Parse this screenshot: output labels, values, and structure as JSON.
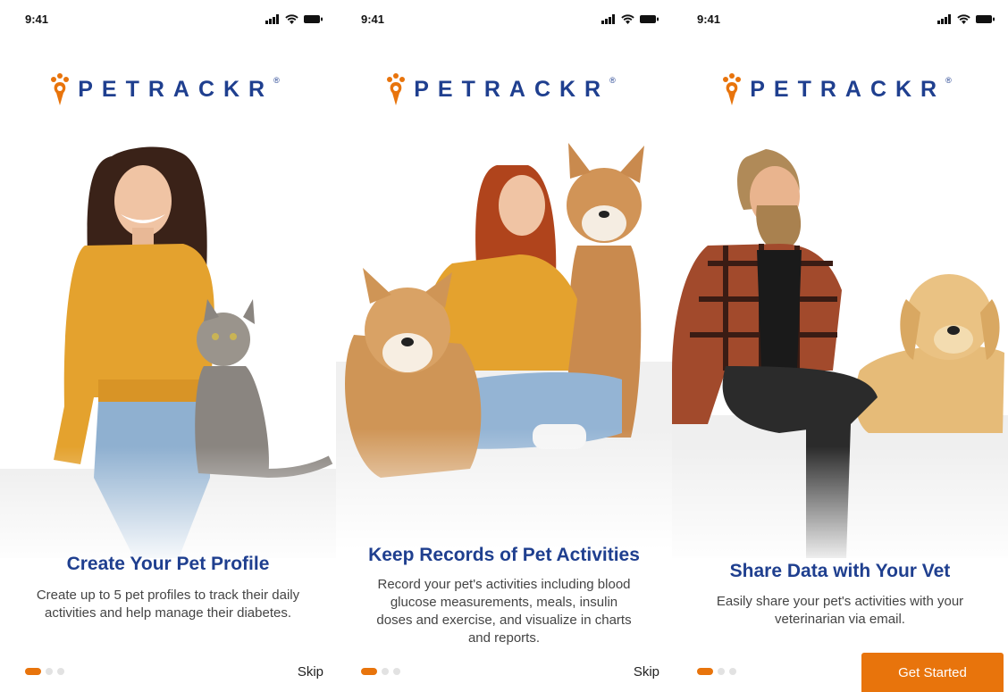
{
  "status_bar": {
    "time": "9:41"
  },
  "brand": {
    "name": "PETRACKR",
    "registered": "®",
    "accent": "#e8740c",
    "primary": "#1f3f8f"
  },
  "screens": [
    {
      "title": "Create Your Pet Profile",
      "description": "Create up to 5 pet profiles to track their daily activities and help manage their diabetes.",
      "action_label": "Skip",
      "active_page": 1,
      "page_count": 3
    },
    {
      "title": "Keep Records of Pet Activities",
      "description": "Record your pet's activities including blood glucose measurements, meals, insulin doses and exercise, and visualize in charts and reports.",
      "action_label": "Skip",
      "active_page": 1,
      "page_count": 3
    },
    {
      "title": "Share Data with Your Vet",
      "description": "Easily share your pet's activities with your veterinarian via email.",
      "action_label": "Get Started",
      "active_page": 1,
      "page_count": 3
    }
  ],
  "icons": [
    "signal-icon",
    "wifi-icon",
    "battery-icon",
    "paw-pin-icon"
  ]
}
